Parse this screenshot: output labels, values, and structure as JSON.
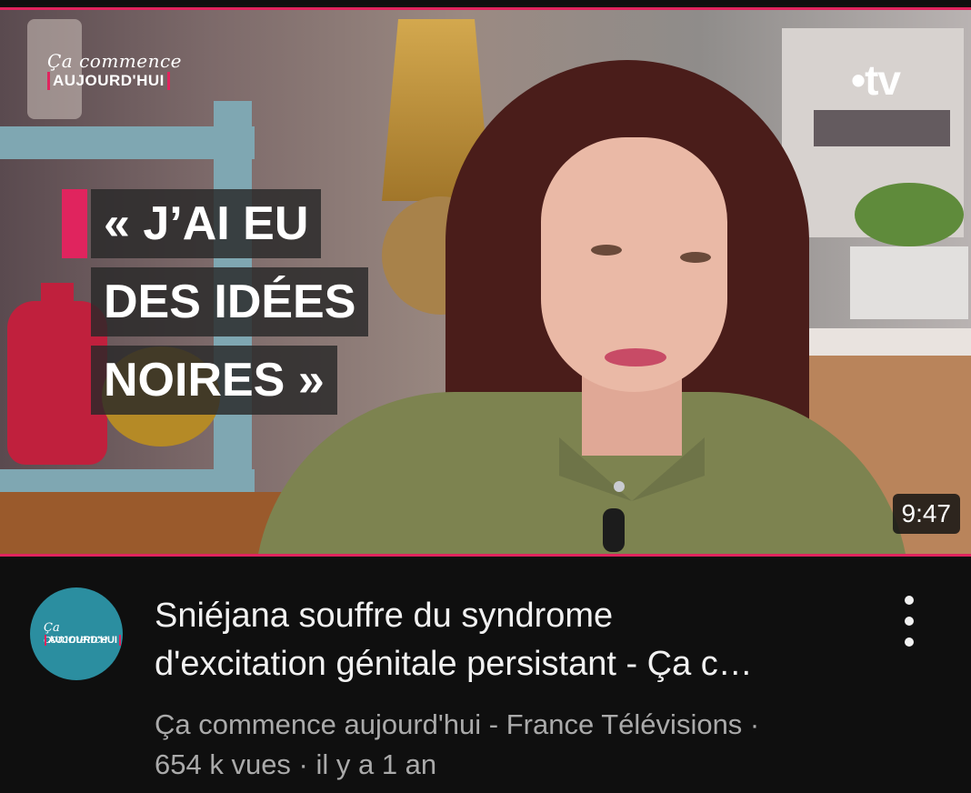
{
  "thumbnail": {
    "show_logo_script": "Ça commence",
    "show_logo_caps": "AUJOURD'HUI",
    "brand": "•tv",
    "quote_lines": [
      "« J’AI EU",
      "DES IDÉES",
      "NOIRES »"
    ],
    "duration": "9:47",
    "accent_color": "#e0245e"
  },
  "channel": {
    "avatar_script": "Ça commence",
    "avatar_caps": "AUJOURD'HUI"
  },
  "video": {
    "title_line1": "Sniéjana souffre du syndrome",
    "title_line2": "d'excitation génitale persistant - Ça c…",
    "channel_line": "Ça commence aujourd'hui - France Télévisions ·",
    "stats_line": "654 k vues · il y a 1 an"
  },
  "menu": {
    "icon": "more-vert-icon"
  }
}
